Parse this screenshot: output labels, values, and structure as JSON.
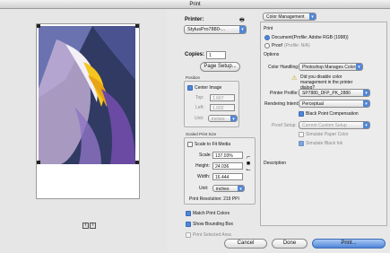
{
  "window": {
    "title": "Print"
  },
  "preview": {
    "prev_icon": "triangle-left-icon",
    "next_icon": "triangle-right-icon"
  },
  "printer": {
    "label": "Printer:",
    "value": "StylusPro7880-..."
  },
  "copies": {
    "label": "Copies:",
    "value": "1"
  },
  "page_setup": {
    "label": "Page Setup..."
  },
  "position": {
    "title": "Position",
    "center_image": "Center Image",
    "top_label": "Top:",
    "top_value": "1.667",
    "left_label": "Left:",
    "left_value": "1.002",
    "unit_label": "Unit:",
    "unit_value": "inches"
  },
  "scaled": {
    "title": "Scaled Print Size",
    "scale_to_fit": "Scale to Fit Media",
    "scale_label": "Scale:",
    "scale_value": "137.03%",
    "height_label": "Height:",
    "height_value": "24.036",
    "width_label": "Width:",
    "width_value": "16.444",
    "unit_label": "Unit:",
    "unit_value": "inches",
    "resolution": "Print Resolution: 219 PPI"
  },
  "options": {
    "match_colors": "Match Print Colors",
    "show_bbox": "Show Bounding Box",
    "print_selected": "Print Selected Area"
  },
  "right": {
    "section": "Color Management",
    "print_heading": "Print",
    "document_label": "Document",
    "document_profile": "(Profile: Adobe RGB (1998))",
    "proof_label": "Proof",
    "proof_profile": "(Profile: N/A)",
    "options_heading": "Options",
    "color_handling_label": "Color Handling:",
    "color_handling_value": "Photoshop Manages Colors",
    "reminder": "Did you disable color management in the printer dialog?",
    "printer_profile_label": "Printer Profile:",
    "printer_profile_value": "SP7880_DFP_PK_2880",
    "intent_label": "Rendering Intent:",
    "intent_value": "Perceptual",
    "bpc": "Black Point Compensation",
    "proof_setup_label": "Proof Setup:",
    "proof_setup_value": "Current Custom Setup",
    "sim_paper": "Simulate Paper Color",
    "sim_ink": "Simulate Black Ink",
    "description_heading": "Description"
  },
  "buttons": {
    "cancel": "Cancel",
    "done": "Done",
    "print": "Print..."
  },
  "colors": {
    "accent": "#4f86d8",
    "background": "#e8e8e8"
  }
}
